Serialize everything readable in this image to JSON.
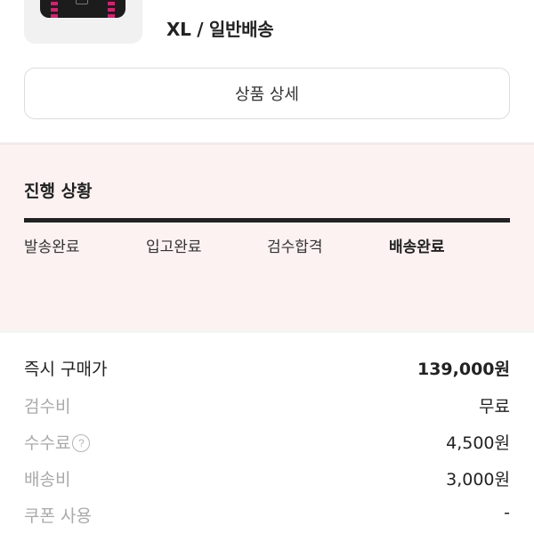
{
  "product": {
    "option": "XL / 일반배송"
  },
  "detail_button": {
    "label": "상품 상세"
  },
  "progress": {
    "title": "진행 상황",
    "steps": [
      {
        "label": "발송완료",
        "current": false
      },
      {
        "label": "입고완료",
        "current": false
      },
      {
        "label": "검수합격",
        "current": false
      },
      {
        "label": "배송완료",
        "current": true
      }
    ],
    "completion": 1.0
  },
  "prices": [
    {
      "label": "즉시 구매가",
      "value": "139,000원"
    },
    {
      "label": "검수비",
      "value": "무료"
    },
    {
      "label": "수수료",
      "value": "4,500원",
      "help_icon": "question-circle-icon"
    },
    {
      "label": "배송비",
      "value": "3,000원"
    },
    {
      "label": "쿠폰 사용",
      "value": "-"
    }
  ],
  "colors": {
    "progress_bg": "#fcf2f1",
    "progress_bar": "#222222",
    "muted_text": "#aaaaaa",
    "product_accent": "#c8286e"
  }
}
